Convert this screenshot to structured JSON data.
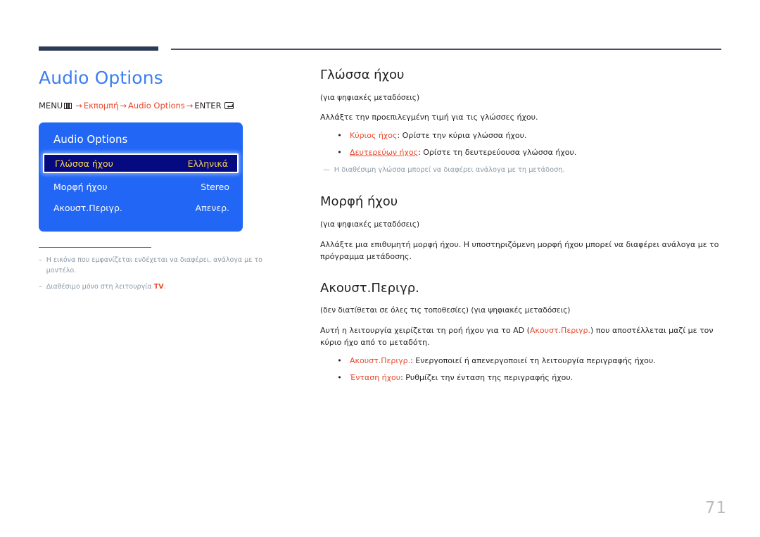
{
  "decor": {
    "thick_rule": "thick-rule",
    "thin_rule": "thin-rule"
  },
  "left": {
    "title": "Audio Options",
    "breadcrumb": {
      "menu_label": "MENU",
      "menu_icon": "menu-grid-icon",
      "arrow": "→",
      "step1": "Εκπομπή",
      "step2": "Audio Options",
      "enter_label": "ENTER",
      "enter_icon": "enter-return-icon"
    },
    "osd": {
      "title": "Audio Options",
      "rows": [
        {
          "label": "Γλώσσα ήχου",
          "value": "Ελληνικά",
          "selected": true
        },
        {
          "label": "Μορφή ήχου",
          "value": "Stereo",
          "selected": false
        },
        {
          "label": "Ακουστ.Περιγρ.",
          "value": "Απενερ.",
          "selected": false
        }
      ]
    },
    "footnotes": [
      {
        "dash": "–",
        "text": "Η εικόνα που εμφανίζεται ενδέχεται να διαφέρει, ανάλογα με το μοντέλο."
      },
      {
        "dash": "–",
        "text": "Διαθέσιμο μόνο στη λειτουργία ",
        "tv": "TV",
        "text_after": "."
      }
    ]
  },
  "right": {
    "sections": [
      {
        "heading": "Γλώσσα ήχου",
        "sub": "(για ψηφιακές μεταδόσεις)",
        "para": "Αλλάξτε την προεπιλεγμένη τιμή για τις γλώσσες ήχου.",
        "bullets": [
          {
            "term": "Κύριος ήχος",
            "rest": ": Ορίστε την κύρια γλώσσα ήχου.",
            "underline": false
          },
          {
            "term": "Δευτερεύων ήχος",
            "rest": ": Ορίστε τη δευτερεύουσα γλώσσα ήχου.",
            "underline": true
          }
        ],
        "note": {
          "dash": "—",
          "text": "Η διαθέσιμη γλώσσα μπορεί να διαφέρει ανάλογα με τη μετάδοση."
        }
      },
      {
        "heading": "Μορφή ήχου",
        "sub": "(για ψηφιακές μεταδόσεις)",
        "para": "Αλλάξτε μια επιθυμητή μορφή ήχου. Η υποστηριζόμενη μορφή ήχου μπορεί να διαφέρει ανάλογα με το πρόγραμμα μετάδοσης."
      },
      {
        "heading": "Ακουστ.Περιγρ.",
        "sub": "(δεν διατίθεται σε όλες τις τοποθεσίες) (για ψηφιακές μεταδόσεις)",
        "para_pre": "Αυτή η λειτουργία χειρίζεται τη ροή ήχου για το AD (",
        "para_red": "Ακουστ.Περιγρ.",
        "para_post": ") που αποστέλλεται μαζί με τον κύριο ήχο από το μεταδότη.",
        "bullets": [
          {
            "term": "Ακουστ.Περιγρ.",
            "rest": ": Ενεργοποιεί ή απενεργοποιεί τη λειτουργία περιγραφής ήχου.",
            "underline": false
          },
          {
            "term": "Ένταση ήχου",
            "rest": ": Ρυθμίζει την ένταση της περιγραφής ήχου.",
            "underline": false
          }
        ]
      }
    ]
  },
  "page_number": "71",
  "colors": {
    "accent_blue": "#3a7ff0",
    "accent_red": "#e8482b",
    "osd_blue": "#2266f5",
    "osd_selected": "#060a80",
    "osd_highlight_text": "#ffd94a",
    "rule_dark": "#2b3a55",
    "note_gray": "#8b99a6",
    "page_num_gray": "#b8bcc2"
  }
}
